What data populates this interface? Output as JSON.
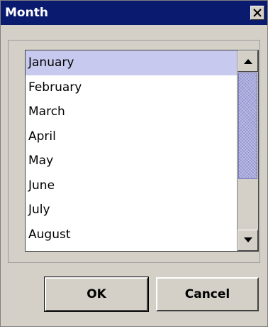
{
  "window": {
    "title": "Month"
  },
  "list": {
    "items": [
      "January",
      "February",
      "March",
      "April",
      "May",
      "June",
      "July",
      "August"
    ],
    "selected": "January"
  },
  "buttons": {
    "ok_label": "OK",
    "cancel_label": "Cancel"
  },
  "colors": {
    "titlebar": "#0a1a6e",
    "selection": "#c7c9ef",
    "scroll_thumb": "#a7a9dc",
    "dialog_bg": "#d4d0c8"
  },
  "icons": {
    "close": "close-icon",
    "scroll_up": "arrow-up-icon",
    "scroll_down": "arrow-down-icon"
  }
}
